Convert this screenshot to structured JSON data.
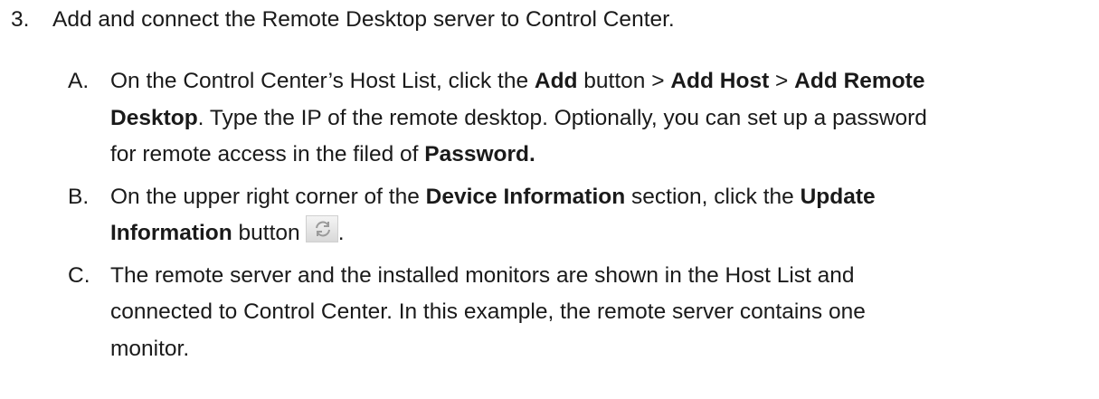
{
  "step": {
    "number": "3.",
    "text": "Add and connect the Remote Desktop server to Control Center."
  },
  "substeps": [
    {
      "letter": "A.",
      "lines": [
        {
          "pre": "On the Control Center’s Host List, click the ",
          "b1": "Add",
          "mid1": " button > ",
          "b2": "Add Host",
          "mid2": " > ",
          "b3": "Add Remote"
        },
        {
          "b1": "Desktop",
          "post": ". Type the IP of the remote desktop. Optionally, you can set up a password"
        },
        {
          "pre": "for remote access in the filed of ",
          "b1": "Password."
        }
      ]
    },
    {
      "letter": "B.",
      "lines": [
        {
          "pre": "On the upper right corner of the ",
          "b1": "Device Information",
          "mid1": " section, click the ",
          "b2": "Update"
        },
        {
          "b1": "Information",
          "post": " button",
          "end": "."
        }
      ]
    },
    {
      "letter": "C.",
      "lines": [
        {
          "text": "The remote server and the installed monitors are shown in the Host List and"
        },
        {
          "text": "connected to Control Center. In this example, the remote server contains one"
        },
        {
          "text": "monitor."
        }
      ]
    }
  ],
  "icons": {
    "update_information": "refresh-icon"
  }
}
